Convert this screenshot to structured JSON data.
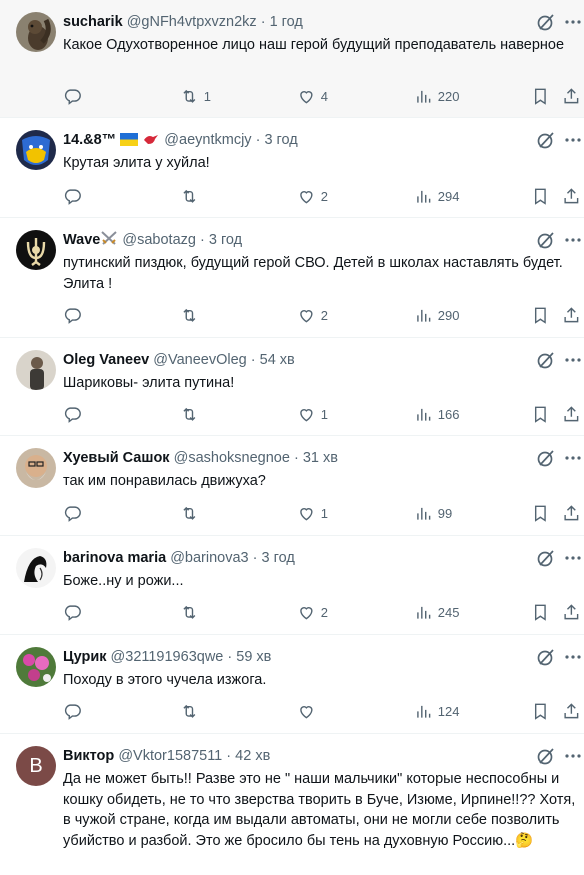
{
  "replies": [
    {
      "name": "sucharik",
      "handle": "@gNFh4vtpxvzn2kz",
      "time": "1 год",
      "text": "Какое Одухотворенное лицо наш герой будущий преподаватель наверное",
      "retweets": "1",
      "likes": "4",
      "views": "220",
      "avatar": "squirrel"
    },
    {
      "name": "14.&8™",
      "handle": "@aeyntkmcjy",
      "time": "3 год",
      "text": "Крутая элита у хуйла!",
      "retweets": "",
      "likes": "2",
      "views": "294",
      "avatar": "ukraine-mask"
    },
    {
      "name": "Wave",
      "handle": "@sabotazg",
      "time": "3 год",
      "text": "путинский пиздюк, будущий герой СВО. Детей в школах наставлять будет. Элита !",
      "retweets": "",
      "likes": "2",
      "views": "290",
      "avatar": "trident"
    },
    {
      "name": "Oleg Vaneev",
      "handle": "@VaneevOleg",
      "time": "54 хв",
      "text": "Шариковы- элита путина!",
      "retweets": "",
      "likes": "1",
      "views": "166",
      "avatar": "man-photo"
    },
    {
      "name": "Хуевый Сашок",
      "handle": "@sashoksnegnoe",
      "time": "31 хв",
      "text": "так им понравилась движуха?",
      "retweets": "",
      "likes": "1",
      "views": "99",
      "avatar": "bearded-man"
    },
    {
      "name": "barinova maria",
      "handle": "@barinova3",
      "time": "3 год",
      "text": "Боже..ну и рожи...",
      "retweets": "",
      "likes": "2",
      "views": "245",
      "avatar": "woman-sketch"
    },
    {
      "name": "Цурик",
      "handle": "@321191963qwe",
      "time": "59 хв",
      "text": "Походу в этого чучела изжога.",
      "retweets": "",
      "likes": "",
      "views": "124",
      "avatar": "flowers"
    },
    {
      "name": "Виктор",
      "handle": "@Vktor1587511",
      "time": "42 хв",
      "text": "Да не может быть!! Разве это не \" наши мальчики\" которые неспособны и кошку обидеть, не то что зверства творить в Буче, Изюме, Ирпине!!?? Хотя, в чужой стране, когда им выдали автоматы, они не могли себе позволить убийство и разбой. Это же бросило бы тень на духовную Россию...🤔",
      "retweets": "",
      "likes": "",
      "views": "",
      "avatar": "letter",
      "avatar_letter": "В"
    }
  ],
  "colors": {
    "text": "#0f1419",
    "muted": "#536471",
    "divider": "#eff3f4",
    "avatar_letter_bg": "#7b4a47"
  },
  "icons": [
    "reply-icon",
    "retweet-icon",
    "like-icon",
    "views-icon",
    "bookmark-icon",
    "share-icon",
    "grok-icon",
    "more-icon"
  ]
}
